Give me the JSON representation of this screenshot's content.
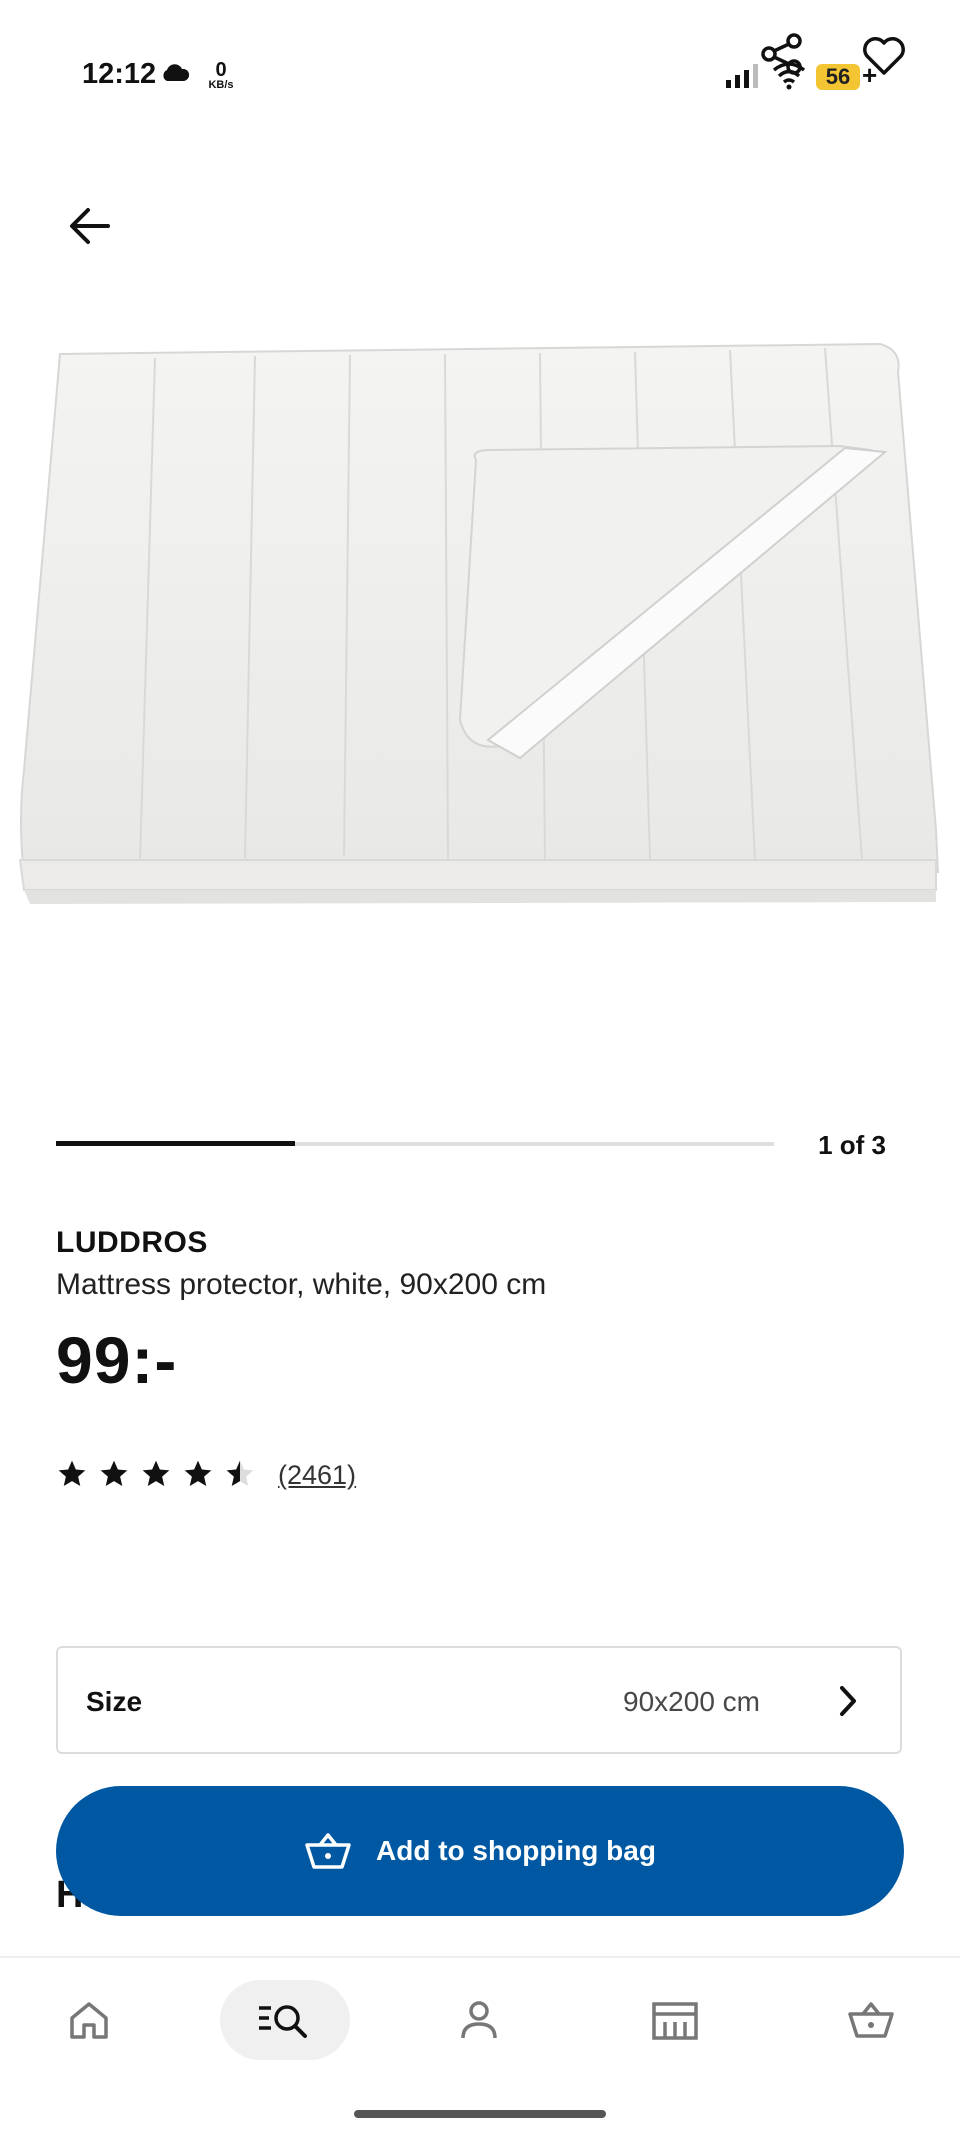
{
  "status_bar": {
    "time": "12:12",
    "net_speed_value": "0",
    "net_speed_unit": "KB/s",
    "battery": "56",
    "battery_suffix": "+"
  },
  "product": {
    "name": "LUDDROS",
    "description": "Mattress protector, white, 90x200 cm",
    "price": "99:-",
    "rating": 4.5,
    "rating_max": 5,
    "review_count": "(2461)"
  },
  "carousel": {
    "counter": "1 of 3",
    "progress": 0.333
  },
  "size_selector": {
    "label": "Size",
    "value": "90x200 cm"
  },
  "add_to_bag": {
    "label": "Add to shopping bag"
  },
  "partial_heading": "H",
  "bottom_nav": {
    "items": [
      {
        "icon": "home-icon"
      },
      {
        "icon": "search-icon",
        "active": true
      },
      {
        "icon": "profile-icon"
      },
      {
        "icon": "store-icon"
      },
      {
        "icon": "basket-icon"
      }
    ]
  },
  "colors": {
    "primary": "#0058a3",
    "battery": "#f3c532",
    "text": "#111111"
  }
}
